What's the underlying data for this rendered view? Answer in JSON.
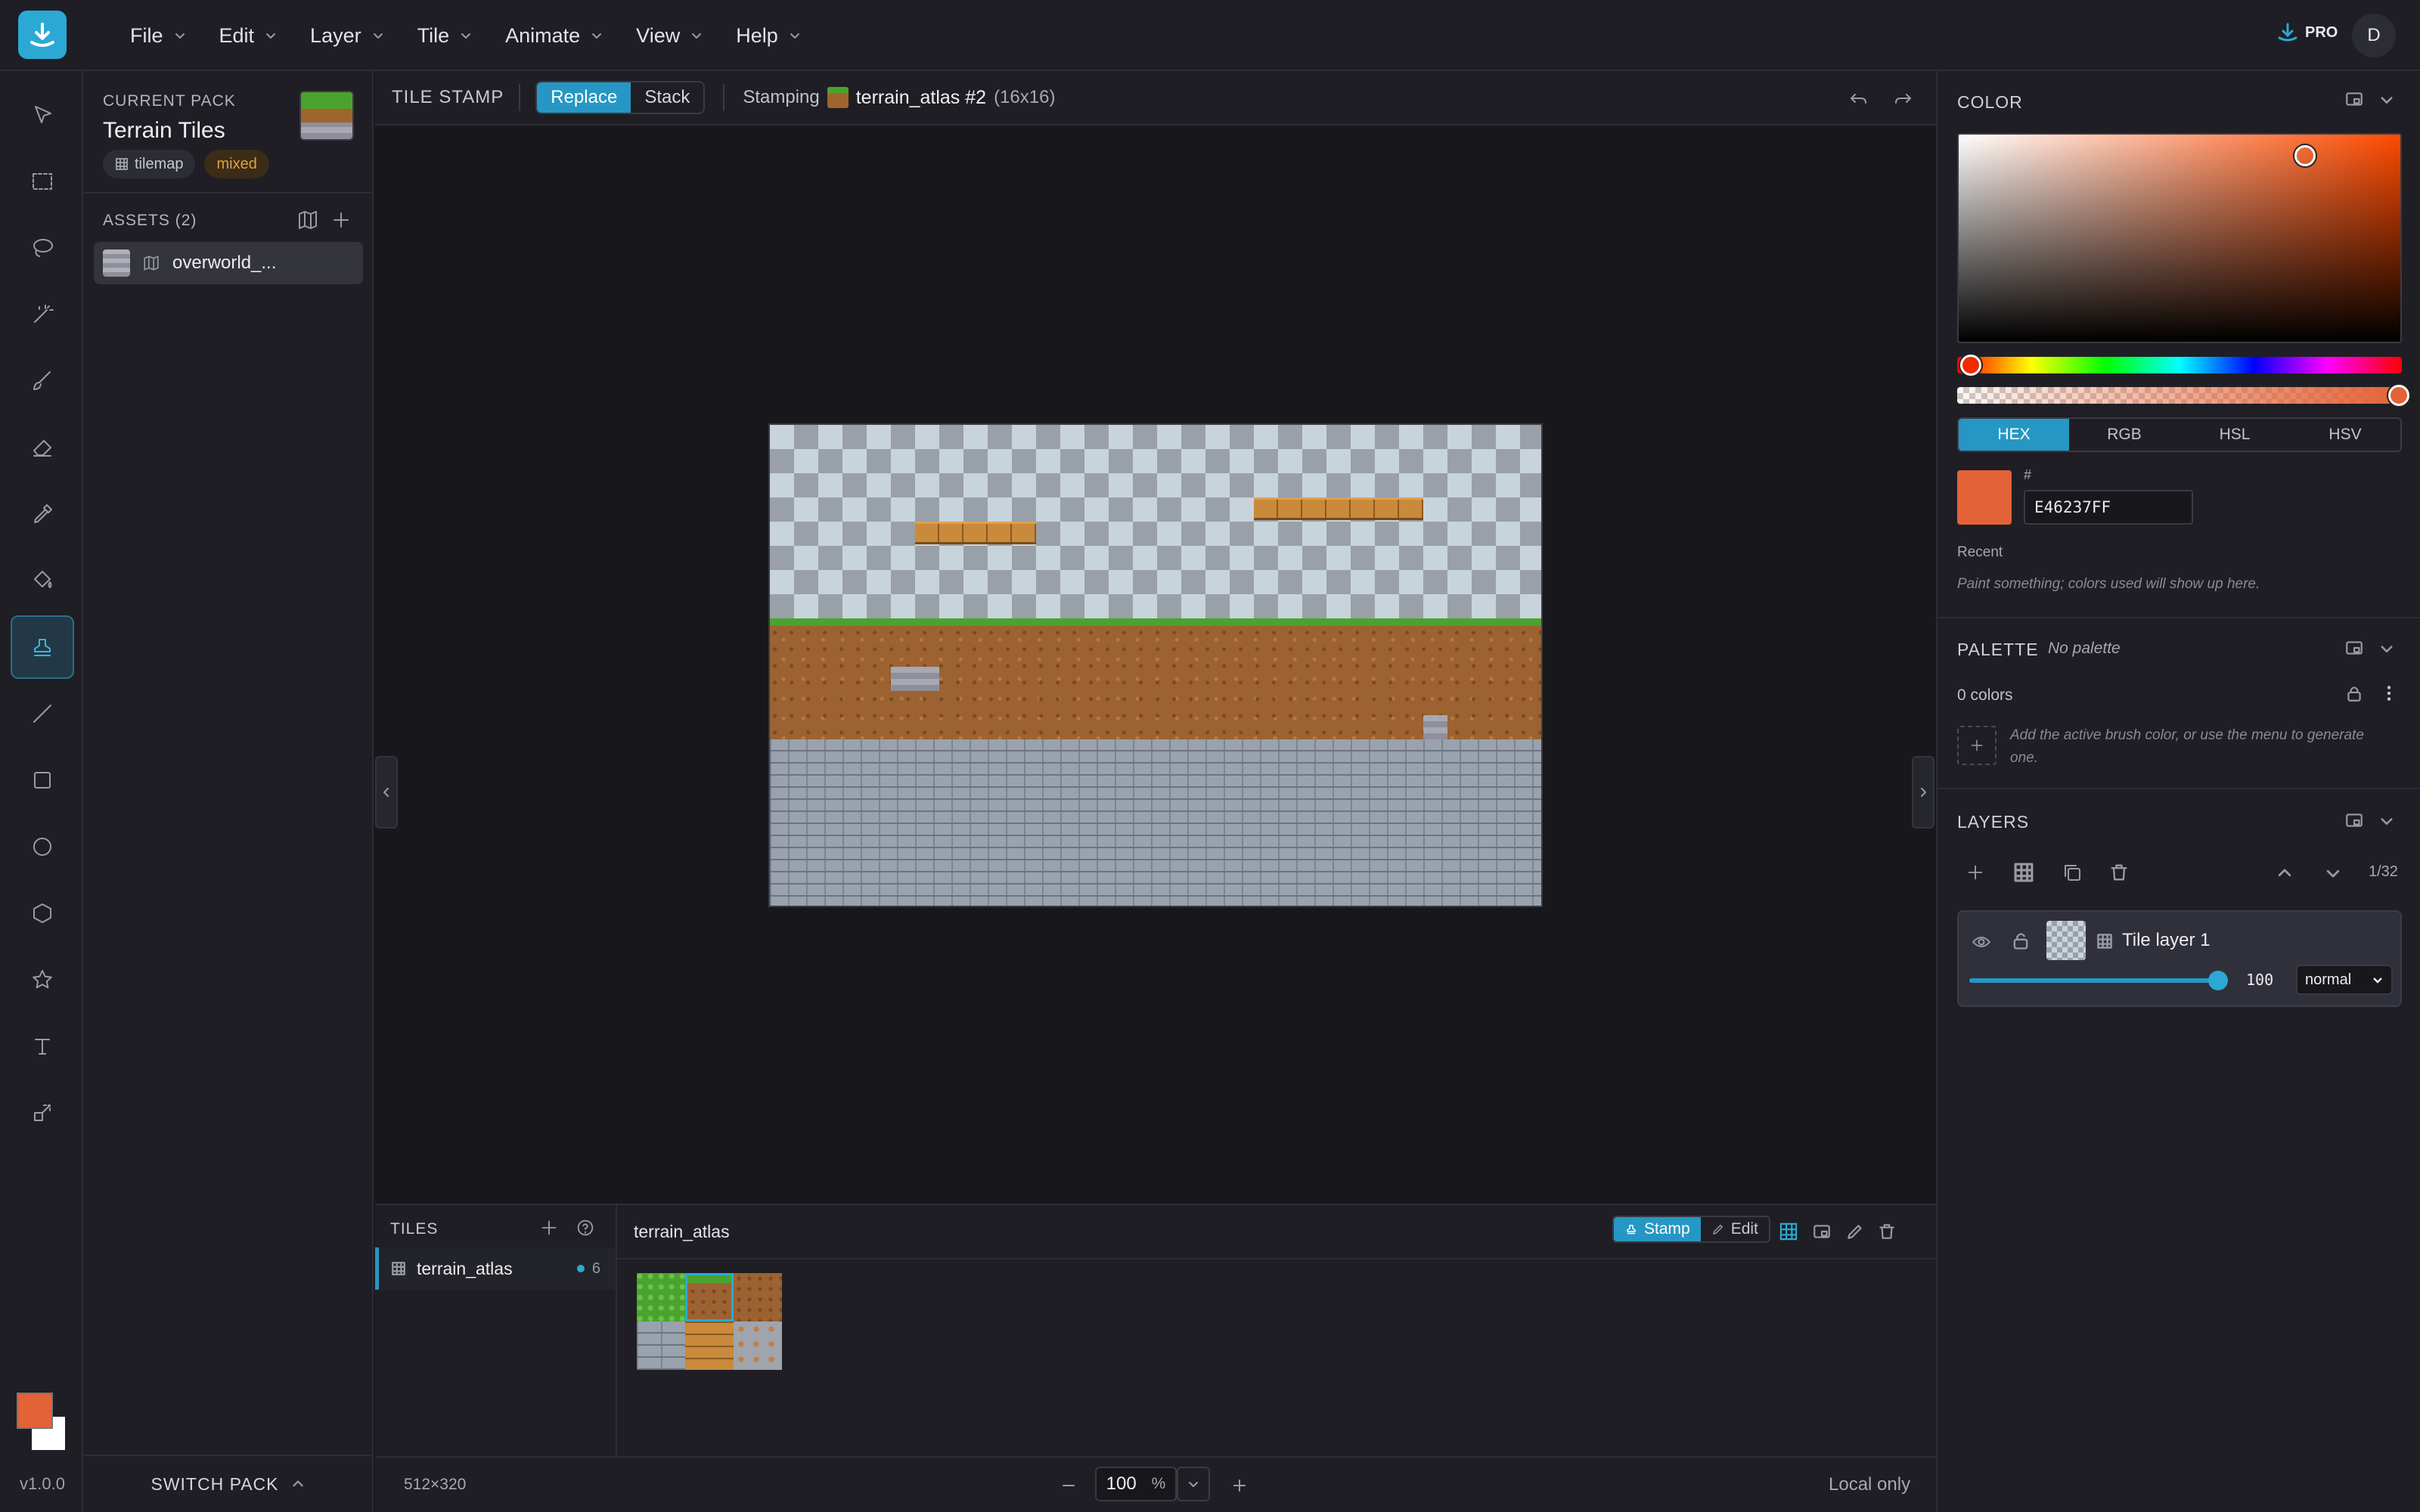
{
  "menus": [
    "File",
    "Edit",
    "Layer",
    "Tile",
    "Animate",
    "View",
    "Help"
  ],
  "account": {
    "pro_label": "PRO",
    "avatar_initial": "D"
  },
  "version": "v1.0.0",
  "pack": {
    "section_label": "CURRENT PACK",
    "name": "Terrain Tiles",
    "chip_tilemap": "tilemap",
    "chip_mixed": "mixed",
    "assets_label": "ASSETS (2)",
    "asset_item": "overworld_...",
    "switch_label": "SWITCH PACK"
  },
  "stampbar": {
    "title": "TILE STAMP",
    "replace_label": "Replace",
    "stack_label": "Stack",
    "stamping_label": "Stamping",
    "atlas_name": "terrain_atlas #2",
    "size_label": "(16x16)"
  },
  "tiles": {
    "title": "TILES",
    "set_name": "terrain_atlas",
    "set_count": "6",
    "atlas_header": "terrain_atlas",
    "stamp_label": "Stamp",
    "edit_label": "Edit"
  },
  "status": {
    "dimensions": "512×320",
    "zoom_value": "100",
    "zoom_unit": "%",
    "storage": "Local only"
  },
  "color": {
    "title": "COLOR",
    "modes": [
      "HEX",
      "RGB",
      "HSL",
      "HSV"
    ],
    "active_mode": "HEX",
    "hash_label": "#",
    "hex_value": "E46237FF",
    "current": "#e46237",
    "recent_label": "Recent",
    "recent_empty": "Paint something; colors used will show up here."
  },
  "palette": {
    "title": "PALETTE",
    "name": "No palette",
    "count": "0 colors",
    "empty_hint": "Add the active brush color, or use the menu to generate one."
  },
  "layers": {
    "title": "LAYERS",
    "counter": "1/32",
    "layer_name": "Tile layer 1",
    "opacity": "100",
    "blend": "normal"
  },
  "colors": {
    "accent": "#2697c4",
    "foreground": "#e46237",
    "background": "#ffffff",
    "mixed_chip": "#e0a040"
  }
}
